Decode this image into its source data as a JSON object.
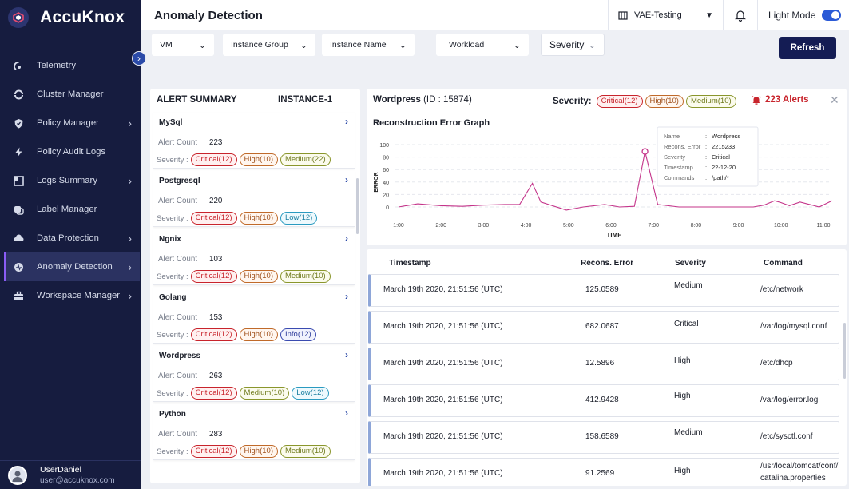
{
  "sidebar": {
    "brand": "AccuKnox",
    "items": [
      {
        "label": "Telemetry",
        "icon": "telemetry-icon",
        "chevron": false
      },
      {
        "label": "Cluster Manager",
        "icon": "cluster-icon",
        "chevron": false
      },
      {
        "label": "Policy Manager",
        "icon": "shield-icon",
        "chevron": true
      },
      {
        "label": "Policy Audit Logs",
        "icon": "bolt-icon",
        "chevron": false
      },
      {
        "label": "Logs Summary",
        "icon": "logs-icon",
        "chevron": true
      },
      {
        "label": "Label Manager",
        "icon": "label-icon",
        "chevron": false
      },
      {
        "label": "Data Protection",
        "icon": "cloud-icon",
        "chevron": true
      },
      {
        "label": "Anomaly Detection",
        "icon": "anomaly-icon",
        "chevron": true,
        "active": true
      },
      {
        "label": "Workspace Manager",
        "icon": "briefcase-icon",
        "chevron": true
      }
    ],
    "user": {
      "name": "UserDaniel",
      "email": "user@accuknox.com"
    }
  },
  "header": {
    "title": "Anomaly Detection",
    "tenant": "VAE-Testing",
    "mode_label": "Light Mode"
  },
  "filters": {
    "vm": "VM",
    "instance_group": "Instance Group",
    "instance_name": "Instance Name",
    "workload": "Workload",
    "severity": "Severity",
    "refresh": "Refresh"
  },
  "alert_summary": {
    "heading": "ALERT SUMMARY",
    "instance": "INSTANCE-1",
    "count_label": "Alert Count",
    "severity_label": "Severity :",
    "cards": [
      {
        "name": "MySql",
        "count": "223",
        "badges": [
          {
            "text": "Critical(12)",
            "kind": "crit"
          },
          {
            "text": "High(10)",
            "kind": "high"
          },
          {
            "text": "Medium(22)",
            "kind": "med"
          }
        ]
      },
      {
        "name": "Postgresql",
        "count": "220",
        "badges": [
          {
            "text": "Critical(12)",
            "kind": "crit"
          },
          {
            "text": "High(10)",
            "kind": "high"
          },
          {
            "text": "Low(12)",
            "kind": "low"
          }
        ]
      },
      {
        "name": "Ngnix",
        "count": "103",
        "badges": [
          {
            "text": "Critical(12)",
            "kind": "crit"
          },
          {
            "text": "High(10)",
            "kind": "high"
          },
          {
            "text": "Medium(10)",
            "kind": "med"
          }
        ]
      },
      {
        "name": "Golang",
        "count": "153",
        "badges": [
          {
            "text": "Critical(12)",
            "kind": "crit"
          },
          {
            "text": "High(10)",
            "kind": "high"
          },
          {
            "text": "Info(12)",
            "kind": "info"
          }
        ]
      },
      {
        "name": "Wordpress",
        "count": "263",
        "badges": [
          {
            "text": "Critical(12)",
            "kind": "crit"
          },
          {
            "text": "Medium(10)",
            "kind": "med"
          },
          {
            "text": "Low(12)",
            "kind": "low"
          }
        ]
      },
      {
        "name": "Python",
        "count": "283",
        "badges": [
          {
            "text": "Critical(12)",
            "kind": "crit"
          },
          {
            "text": "High(10)",
            "kind": "high"
          },
          {
            "text": "Medium(10)",
            "kind": "med"
          }
        ]
      }
    ]
  },
  "detail": {
    "name": "Wordpress",
    "id_text": "(ID : 15874)",
    "severity_label": "Severity:",
    "badges": [
      {
        "text": "Critical(12)",
        "kind": "crit"
      },
      {
        "text": "High(10)",
        "kind": "high"
      },
      {
        "text": "Medium(10)",
        "kind": "med"
      }
    ],
    "alerts": "223 Alerts",
    "graph_title": "Reconstruction Error Graph",
    "tooltip": [
      {
        "k": "Name",
        "v": "Wordpress"
      },
      {
        "k": "Recons. Error",
        "v": "2215233"
      },
      {
        "k": "Severity",
        "v": "Critical"
      },
      {
        "k": "Timestamp",
        "v": "22-12-20"
      },
      {
        "k": "Commands",
        "v": "/path/*"
      }
    ]
  },
  "chart_data": {
    "type": "line",
    "xlabel": "TIME",
    "ylabel": "ERROR",
    "ylim": [
      0,
      100
    ],
    "yticks": [
      "100",
      "80",
      "60",
      "40",
      "20",
      "0"
    ],
    "xticks": [
      "1:00",
      "2:00",
      "3:00",
      "4:00",
      "5:00",
      "6:00",
      "7:00",
      "8:00",
      "9:00",
      "10:00",
      "11:00"
    ],
    "color": "#c4348a",
    "points": [
      [
        1.0,
        0
      ],
      [
        1.45,
        5
      ],
      [
        2.0,
        2
      ],
      [
        2.5,
        1
      ],
      [
        3.0,
        3
      ],
      [
        3.5,
        4
      ],
      [
        3.85,
        4
      ],
      [
        4.15,
        38
      ],
      [
        4.35,
        8
      ],
      [
        4.95,
        -5
      ],
      [
        5.35,
        0
      ],
      [
        5.85,
        4
      ],
      [
        6.2,
        0
      ],
      [
        6.55,
        1
      ],
      [
        6.8,
        89
      ],
      [
        7.1,
        4
      ],
      [
        7.6,
        0
      ],
      [
        8.2,
        0
      ],
      [
        8.8,
        0
      ],
      [
        9.35,
        0
      ],
      [
        9.6,
        3
      ],
      [
        9.85,
        10
      ],
      [
        10.0,
        7
      ],
      [
        10.2,
        2
      ],
      [
        10.45,
        8
      ],
      [
        10.9,
        0
      ],
      [
        11.2,
        10
      ]
    ],
    "highlight": [
      6.8,
      89
    ]
  },
  "table": {
    "headers": [
      "Timestamp",
      "Recons. Error",
      "Severity",
      "Command"
    ],
    "rows": [
      {
        "ts": "March 19th 2020, 21:51:56 (UTC)",
        "err": "125.0589",
        "sev": "Medium",
        "cmd": "/etc/network"
      },
      {
        "ts": "March 19th 2020, 21:51:56 (UTC)",
        "err": "682.0687",
        "sev": "Critical",
        "cmd": "/var/log/mysql.conf"
      },
      {
        "ts": "March 19th 2020, 21:51:56 (UTC)",
        "err": "12.5896",
        "sev": "High",
        "cmd": "/etc/dhcp"
      },
      {
        "ts": "March 19th 2020, 21:51:56 (UTC)",
        "err": "412.9428",
        "sev": "High",
        "cmd": "/var/log/error.log"
      },
      {
        "ts": "March 19th 2020, 21:51:56 (UTC)",
        "err": "158.6589",
        "sev": "Medium",
        "cmd": "/etc/sysctl.conf"
      },
      {
        "ts": "March 19th 2020, 21:51:56 (UTC)",
        "err": "91.2569",
        "sev": "High",
        "cmd": "/usr/local/tomcat/conf/ catalina.properties"
      }
    ]
  }
}
